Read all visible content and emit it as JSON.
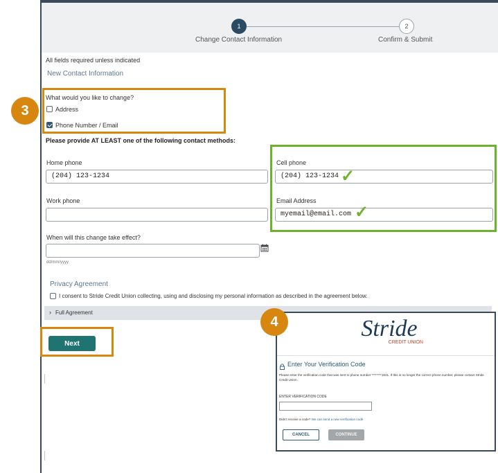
{
  "stepper": {
    "step1_number": "1",
    "step1_label": "Change Contact Information",
    "step2_number": "2",
    "step2_label": "Confirm & Submit"
  },
  "form": {
    "required_note": "All fields required unless indicated",
    "section_title": "New Contact Information",
    "change_question": "What would you like to change?",
    "options": [
      {
        "label": "Address",
        "checked": false
      },
      {
        "label": "Phone Number / Email",
        "checked": true
      }
    ],
    "methods_heading": "Please provide AT LEAST one of the following contact methods:",
    "home_phone_label": "Home phone",
    "home_phone_value": "(204) 123-1234",
    "cell_phone_label": "Cell phone",
    "cell_phone_value": "(204) 123-1234",
    "work_phone_label": "Work phone",
    "work_phone_value": "",
    "email_label": "Email Address",
    "email_value": "myemail@email.com",
    "effective_label": "When will this change take effect?",
    "date_hint": "dd/mm/yyyy",
    "calendar_icon": "calendar-icon",
    "privacy_title": "Privacy Agreement",
    "privacy_consent": "I consent to Stride Credit Union collecting, using and disclosing my personal information as described in the agreement below.",
    "full_agreement": "Full Agreement",
    "next_label": "Next"
  },
  "annotations": {
    "badge3": "3",
    "badge4": "4",
    "accent_orange": "#d7860f",
    "accent_green": "#6cb22c"
  },
  "popup": {
    "logo_word": "Stride",
    "logo_sub": "CREDIT UNION",
    "title": "Enter Your Verification Code",
    "lock_icon": "lock-icon",
    "body": "Please enter the verification code that was sent to phone number ********1931. If this is no longer the correct phone number, please contact Stride Credit Union.",
    "code_label": "ENTER VERIFICATION CODE",
    "code_value": "",
    "resend_prefix": "Didn't receive a code?",
    "resend_link": "We can send a new verification code",
    "cancel_label": "CANCEL",
    "continue_label": "CONTINUE"
  },
  "colors": {
    "primary": "#1f7472",
    "step_active": "#2b4a63",
    "logo_red": "#d1422b",
    "logo_navy": "#1f3a57"
  }
}
